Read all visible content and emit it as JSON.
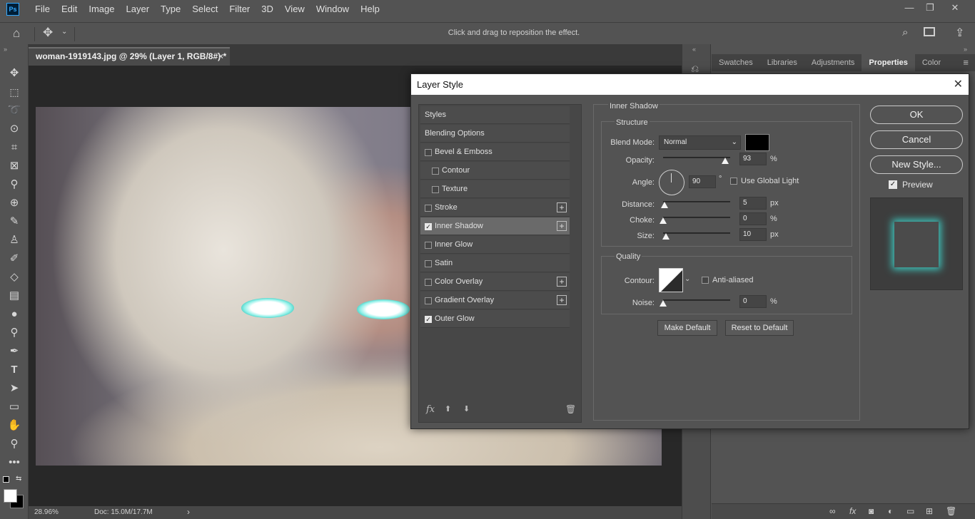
{
  "app": {
    "logo": "Ps"
  },
  "menu": [
    "File",
    "Edit",
    "Image",
    "Layer",
    "Type",
    "Select",
    "Filter",
    "3D",
    "View",
    "Window",
    "Help"
  ],
  "window_controls": {
    "minimize": "—",
    "restore": "❐",
    "close": "✕"
  },
  "options_bar": {
    "hint": "Click and drag to reposition the effect."
  },
  "document": {
    "tab_title": "woman-1919143.jpg @ 29% (Layer 1, RGB/8#) *",
    "close": "×",
    "zoom": "28.96%",
    "doc_size": "Doc: 15.0M/17.7M",
    "arrow": "›"
  },
  "panel_tabs": [
    "Swatches",
    "Libraries",
    "Adjustments",
    "Properties",
    "Color"
  ],
  "panel_active_tab": "Properties",
  "dialog": {
    "title": "Layer Style",
    "close": "✕",
    "styles": [
      {
        "label": "Styles",
        "checkbox": false,
        "checked": false,
        "plus": false,
        "indent": 0,
        "selected": false
      },
      {
        "label": "Blending Options",
        "checkbox": false,
        "checked": false,
        "plus": false,
        "indent": 0,
        "selected": false
      },
      {
        "label": "Bevel & Emboss",
        "checkbox": true,
        "checked": false,
        "plus": false,
        "indent": 0,
        "selected": false
      },
      {
        "label": "Contour",
        "checkbox": true,
        "checked": false,
        "plus": false,
        "indent": 1,
        "selected": false
      },
      {
        "label": "Texture",
        "checkbox": true,
        "checked": false,
        "plus": false,
        "indent": 1,
        "selected": false
      },
      {
        "label": "Stroke",
        "checkbox": true,
        "checked": false,
        "plus": true,
        "indent": 0,
        "selected": false
      },
      {
        "label": "Inner Shadow",
        "checkbox": true,
        "checked": true,
        "plus": true,
        "indent": 0,
        "selected": true
      },
      {
        "label": "Inner Glow",
        "checkbox": true,
        "checked": false,
        "plus": false,
        "indent": 0,
        "selected": false
      },
      {
        "label": "Satin",
        "checkbox": true,
        "checked": false,
        "plus": false,
        "indent": 0,
        "selected": false
      },
      {
        "label": "Color Overlay",
        "checkbox": true,
        "checked": false,
        "plus": true,
        "indent": 0,
        "selected": false
      },
      {
        "label": "Gradient Overlay",
        "checkbox": true,
        "checked": false,
        "plus": true,
        "indent": 0,
        "selected": false
      },
      {
        "label": "Outer Glow",
        "checkbox": true,
        "checked": true,
        "plus": false,
        "indent": 0,
        "selected": false
      }
    ],
    "footer_fx": "fx",
    "section_title": "Inner Shadow",
    "structure": {
      "title": "Structure",
      "blend_mode_label": "Blend Mode:",
      "blend_mode_value": "Normal",
      "shadow_color": "#000000",
      "opacity_label": "Opacity:",
      "opacity_value": "93",
      "opacity_level": 0.93,
      "angle_label": "Angle:",
      "angle_value": "90",
      "degree": "°",
      "use_global_light": "Use Global Light",
      "distance_label": "Distance:",
      "distance_value": "5",
      "distance_level": 0.02,
      "choke_label": "Choke:",
      "choke_value": "0",
      "choke_level": 0.0,
      "size_label": "Size:",
      "size_value": "10",
      "size_level": 0.04,
      "unit_percent": "%",
      "unit_px": "px"
    },
    "quality": {
      "title": "Quality",
      "contour_label": "Contour:",
      "anti_aliased": "Anti-aliased",
      "noise_label": "Noise:",
      "noise_value": "0",
      "noise_level": 0.0
    },
    "make_default": "Make Default",
    "reset_default": "Reset to Default",
    "ok": "OK",
    "cancel": "Cancel",
    "new_style": "New Style...",
    "preview": "Preview",
    "preview_glow_color": "#3ec9c0"
  }
}
